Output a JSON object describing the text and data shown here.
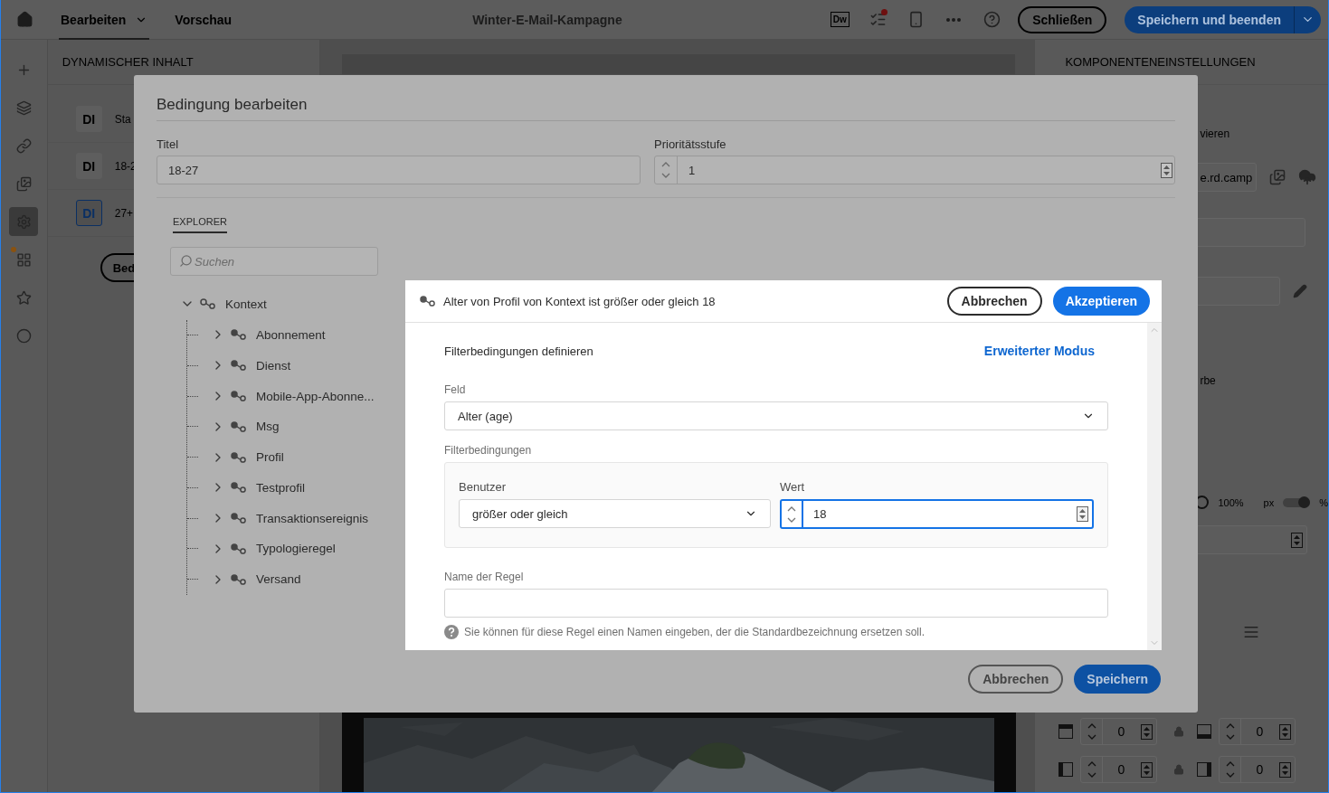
{
  "top_bar": {
    "tabs": [
      {
        "label": "Bearbeiten",
        "selected": true,
        "has_menu": true
      },
      {
        "label": "Vorschau",
        "selected": false,
        "has_menu": false
      }
    ],
    "title": "Winter-E-Mail-Kampagne",
    "tools": [
      {
        "kind": "code",
        "label": "Dw",
        "alert": false
      },
      {
        "kind": "checklist",
        "alert": true
      },
      {
        "kind": "mobile",
        "alert": false
      },
      {
        "kind": "more",
        "alert": false
      },
      {
        "kind": "help",
        "alert": false
      }
    ],
    "buttons": [
      {
        "label": "Schließen",
        "kind": "outline"
      },
      {
        "label": "Speichern und beenden",
        "kind": "primary"
      }
    ]
  },
  "left_rail": {
    "items": [
      {
        "kind": "plus",
        "selected": false,
        "alert": false
      },
      {
        "kind": "layers",
        "selected": false,
        "alert": false
      },
      {
        "kind": "link",
        "selected": false,
        "alert": false
      },
      {
        "kind": "images",
        "selected": false,
        "alert": false
      },
      {
        "kind": "personalize",
        "selected": true,
        "alert": false
      },
      {
        "kind": "grid",
        "selected": false,
        "alert": true
      },
      {
        "kind": "fragment",
        "selected": false,
        "alert": false
      },
      {
        "kind": "circle",
        "selected": false,
        "alert": false
      }
    ]
  },
  "dynamic_content": {
    "title": "DYNAMISCHER INHALT",
    "items": [
      {
        "badge": "DI",
        "label": "Sta",
        "selected": false
      },
      {
        "badge": "DI",
        "label": "18-2",
        "selected": false
      },
      {
        "badge": "DI",
        "label": "27+",
        "selected": true
      }
    ],
    "button": "Bed"
  },
  "component_settings": {
    "title": "KOMPONENTENEINSTELLUNGEN",
    "label_1": "vieren",
    "url_value": "e.rd.camp",
    "label_2": "rbe",
    "width_option": {
      "label": "100%",
      "selected": false
    },
    "unit_left": "px",
    "unit_toggle_on": true,
    "unit_right": "%",
    "spacing_rows": [
      {
        "cells": [
          {
            "kind": "top",
            "value": "0"
          },
          {
            "kind": "bottom",
            "value": "0"
          }
        ]
      },
      {
        "cells": [
          {
            "kind": "left",
            "value": "0"
          },
          {
            "kind": "right",
            "value": "0"
          }
        ]
      }
    ]
  },
  "condition_dialog": {
    "title": "Bedingung bearbeiten",
    "title_label": "Titel",
    "title_value": "18-27",
    "priority_label": "Prioritätsstufe",
    "priority_value": "1",
    "explorer": {
      "tab": "EXPLORER",
      "search_placeholder": "Suchen",
      "tree": {
        "label": "Kontext",
        "expanded": true,
        "children": [
          {
            "label": "Abonnement",
            "expanded": false
          },
          {
            "label": "Dienst",
            "expanded": false
          },
          {
            "label": "Mobile-App-Abonne...",
            "expanded": false
          },
          {
            "label": "Msg",
            "expanded": false
          },
          {
            "label": "Profil",
            "expanded": false
          },
          {
            "label": "Testprofil",
            "expanded": false
          },
          {
            "label": "Transaktionsereignis",
            "expanded": false
          },
          {
            "label": "Typologieregel",
            "expanded": false
          },
          {
            "label": "Versand",
            "expanded": false
          }
        ]
      }
    },
    "buttons": [
      {
        "label": "Abbrechen",
        "kind": "outline"
      },
      {
        "label": "Speichern",
        "kind": "primary"
      }
    ]
  },
  "filter_dialog": {
    "summary": "Alter von Profil von Kontext ist größer oder gleich 18",
    "buttons": [
      {
        "label": "Abbrechen",
        "kind": "outline"
      },
      {
        "label": "Akzeptieren",
        "kind": "primary"
      }
    ],
    "heading": "Filterbedingungen definieren",
    "advanced_link": "Erweiterter Modus",
    "field_label": "Feld",
    "field_value": "Alter (age)",
    "conditions_label": "Filterbedingungen",
    "operator_label": "Benutzer",
    "operator_value": "größer oder gleich",
    "value_label": "Wert",
    "value": "18",
    "value_focused": true,
    "rule_name_label": "Name der Regel",
    "help": "Sie können für diese Regel einen Namen eingeben, der die Standardbezeichnung ersetzen soll."
  }
}
